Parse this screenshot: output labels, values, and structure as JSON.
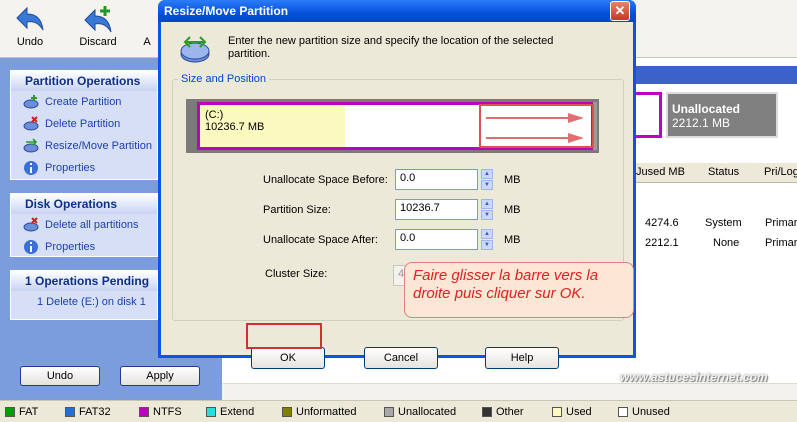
{
  "toolbar": {
    "undo_label": "Undo",
    "discard_label": "Discard",
    "apply_label_partial": "A"
  },
  "sidebar": {
    "partition_ops": {
      "title": "Partition Operations",
      "items": [
        {
          "label": "Create Partition",
          "icon": "create-partition-icon"
        },
        {
          "label": "Delete Partition",
          "icon": "delete-partition-icon"
        },
        {
          "label": "Resize/Move Partition",
          "icon": "resize-partition-icon"
        },
        {
          "label": "Properties",
          "icon": "info-icon"
        }
      ]
    },
    "disk_ops": {
      "title": "Disk Operations",
      "items": [
        {
          "label": "Delete all partitions",
          "icon": "delete-all-icon"
        },
        {
          "label": "Properties",
          "icon": "info-icon"
        }
      ]
    },
    "pending": {
      "title": "1 Operations Pending",
      "items": [
        {
          "label": "1  Delete (E:) on disk 1"
        }
      ]
    },
    "undo_button": "Undo",
    "apply_button": "Apply"
  },
  "disk_map": {
    "unallocated_label": "Unallocated",
    "unallocated_size": "2212.1 MB"
  },
  "table": {
    "columns": [
      "Jused MB",
      "Status",
      "Pri/Log"
    ],
    "rows": [
      {
        "used": "4274.6",
        "status": "System",
        "type": "Primar"
      },
      {
        "used": "2212.1",
        "status": "None",
        "type": "Primar"
      }
    ]
  },
  "watermark": "www.astucesinternet.com",
  "legend": [
    {
      "label": "FAT",
      "color": "#00a000"
    },
    {
      "label": "FAT32",
      "color": "#1e73d2"
    },
    {
      "label": "NTFS",
      "color": "#c000c0"
    },
    {
      "label": "Extend",
      "color": "#20e0e0"
    },
    {
      "label": "Unformatted",
      "color": "#808000"
    },
    {
      "label": "Unallocated",
      "color": "#a8a8a8"
    },
    {
      "label": "Other",
      "color": "#333333"
    },
    {
      "label": "Used",
      "color": "#fbf8c0"
    },
    {
      "label": "Unused",
      "color": "#ffffff"
    }
  ],
  "dialog": {
    "title": "Resize/Move Partition",
    "close": "✕",
    "intro": "Enter the new partition size and specify the location of the selected partition.",
    "group_title": "Size and Position",
    "partition_name": "(C:)",
    "partition_size": "10236.7 MB",
    "fields": {
      "before_label": "Unallocate Space Before:",
      "before_value": "0.0",
      "size_label": "Partition Size:",
      "size_value": "10236.7",
      "after_label": "Unallocate Space After:",
      "after_value": "0.0",
      "cluster_label": "Cluster Size:",
      "cluster_value": "4",
      "unit": "MB"
    },
    "ok": "OK",
    "cancel": "Cancel",
    "help": "Help"
  },
  "annotation": "Faire glisser la barre vers la droite puis cliquer sur OK."
}
